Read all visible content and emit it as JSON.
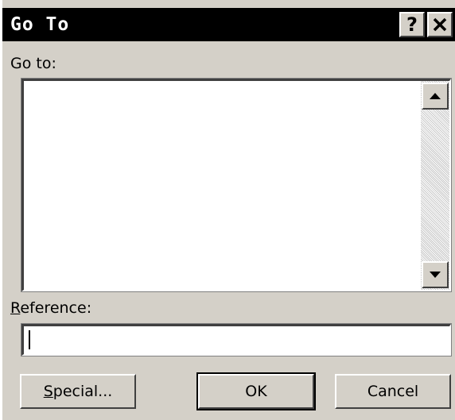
{
  "dialog": {
    "title": "Go To",
    "help_label": "?",
    "close_label": "✕"
  },
  "goto": {
    "label": "Go to:",
    "items": []
  },
  "reference": {
    "label_accel": "R",
    "label_rest": "eference:",
    "value": ""
  },
  "buttons": {
    "special_accel": "S",
    "special_rest": "pecial...",
    "ok": "OK",
    "cancel": "Cancel"
  },
  "colors": {
    "face": "#d4d0c8",
    "titlebar": "#000000"
  }
}
